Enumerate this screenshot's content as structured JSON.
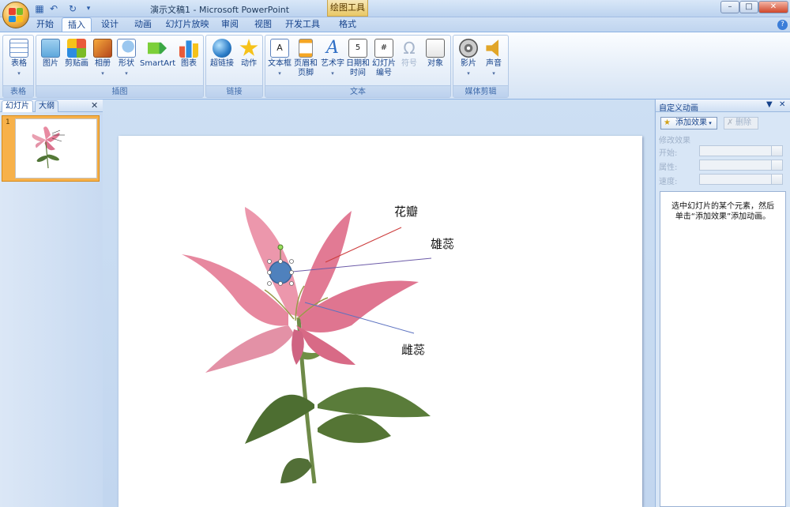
{
  "window": {
    "title": "演示文稿1 - Microsoft PowerPoint",
    "context_group": "绘图工具"
  },
  "ribbon_tabs": [
    "开始",
    "插入",
    "设计",
    "动画",
    "幻灯片放映",
    "审阅",
    "视图",
    "开发工具",
    "格式"
  ],
  "active_tab": "插入",
  "groups": {
    "table": {
      "label": "表格",
      "buttons": [
        "表格"
      ]
    },
    "illustrations": {
      "label": "插图",
      "buttons": [
        "图片",
        "剪贴画",
        "相册",
        "形状",
        "SmartArt",
        "图表"
      ]
    },
    "links": {
      "label": "链接",
      "buttons": [
        "超链接",
        "动作"
      ]
    },
    "text": {
      "label": "文本",
      "buttons": [
        "文本框",
        "页眉和页脚",
        "艺术字",
        "日期和时间",
        "幻灯片编号",
        "符号",
        "对象"
      ]
    },
    "media": {
      "label": "媒体剪辑",
      "buttons": [
        "影片",
        "声音"
      ]
    }
  },
  "left_panel": {
    "tabs": [
      "幻灯片",
      "大纲"
    ],
    "slide_number": "1"
  },
  "slide": {
    "labels": [
      "花瓣",
      "雄蕊",
      "雌蕊"
    ]
  },
  "task_pane": {
    "title": "自定义动画",
    "add_effect": "添加效果",
    "remove": "删除",
    "modify_header": "修改效果",
    "fields": [
      "开始:",
      "属性:",
      "速度:"
    ],
    "hint": "选中幻灯片的某个元素，然后单击“添加效果”添加动画。"
  },
  "colors": {
    "ribbon_bg": "#dfe9f5",
    "accent": "#15428b",
    "thumb_border": "#f7b14a"
  }
}
